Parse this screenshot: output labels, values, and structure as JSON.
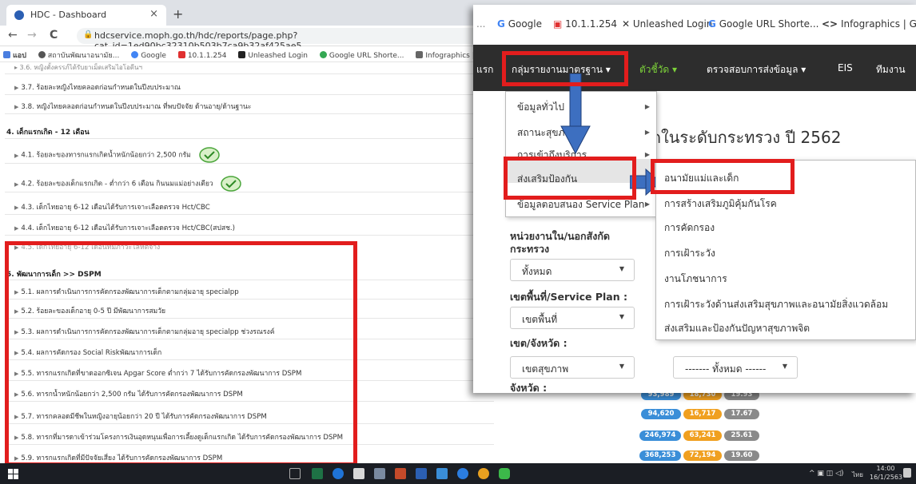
{
  "browser": {
    "tab_title": "HDC - Dashboard",
    "tab_close": "×",
    "new_tab": "+",
    "back": "←",
    "forward": "→",
    "reload": "C",
    "url": "hdcservice.moph.go.th/hdc/reports/page.php?cat_id=1ed90bc32310b503b7ca9b32af425ae5",
    "bookmarks": [
      "แอป",
      "สถาบันพัฒนาอนามัย...",
      "Google",
      "10.1.1.254",
      "Unleashed Login",
      "Google URL Shorte...",
      "Infographics | Goo...",
      "Ne"
    ]
  },
  "report": {
    "cutoff_row": "▸ 3.6. หญิงตั้งครรภ์ได้รับยาเม็ดเสริมไอโอดีนฯ",
    "rows_section3": [
      "3.7. ร้อยละหญิงไทยคลอดก่อนกำหนดในปีงบประมาณ",
      "3.8. หญิงไทยคลอดก่อนกำหนดในปีงบประมาณ ที่พบปัจจัย ด้านอายุ/ด้านฐานะ"
    ],
    "section4_title": "4. เด็กแรกเกิด - 12 เดือน",
    "rows_section4": [
      "4.1. ร้อยละของทารกแรกเกิดน้ำหนักน้อยกว่า 2,500 กรัม",
      "4.2. ร้อยละของเด็กแรกเกิด - ต่ำกว่า 6 เดือน กินนมแม่อย่างเดียว",
      "4.3. เด็กไทยอายุ 6-12 เดือนได้รับการเจาะเลือดตรวจ Hct/CBC",
      "4.4. เด็กไทยอายุ 6-12 เดือนได้รับการเจาะเลือดตรวจ Hct/CBC(สปสช.)",
      "4.5. เด็กไทยอายุ 6-12 เดือนที่มีภาวะโลหิตจาง"
    ],
    "section5_title": "5. พัฒนาการเด็ก >> DSPM",
    "rows_section5": [
      "5.1. ผลการดำเนินการการคัดกรองพัฒนาการเด็กตามกลุ่มอายุ specialpp",
      "5.2. ร้อยละของเด็กอายุ 0-5 ปี มีพัฒนาการสมวัย",
      "5.3. ผลการดำเนินการการคัดกรองพัฒนาการเด็กตามกลุ่มอายุ specialpp ช่วงรณรงค์",
      "5.4. ผลการคัดกรอง Social Riskพัฒนาการเด็ก",
      "5.5. ทารกแรกเกิดที่ขาดออกซิเจน Apgar Score ต่ำกว่า 7 ได้รับการคัดกรองพัฒนาการ DSPM",
      "5.6. ทารกน้ำหนักน้อยกว่า 2,500 กรัม ได้รับการคัดกรองพัฒนาการ DSPM",
      "5.7. ทารกคลอดมีชีพในหญิงอายุน้อยกว่า 20 ปี ได้รับการคัดกรองพัฒนาการ DSPM",
      "5.8. ทารกที่มารดาเข้าร่วมโครงการเงินอุดหนุนเพื่อการเลี้ยงดูเด็กแรกเกิด ได้รับการคัดกรองพัฒนาการ DSPM",
      "5.9. ทารกแรกเกิดที่มีปัจจัยเสี่ยง ได้รับการคัดกรองพัฒนาการ DSPM"
    ],
    "badges": [
      {
        "a": "93,989",
        "b": "18,730",
        "c": "19.93"
      },
      {
        "a": "94,620",
        "b": "16,717",
        "c": "17.67"
      },
      {
        "a": "246,974",
        "b": "63,241",
        "c": "25.61"
      },
      {
        "a": "368,253",
        "b": "72,194",
        "c": "19.60"
      }
    ],
    "badge_colors": {
      "blue": "#3a8ed8",
      "orange": "#f0a020",
      "gray": "#8a8a8a"
    }
  },
  "overlay": {
    "bookmarks": [
      "Google",
      "10.1.1.254",
      "Unleashed Login",
      "Google URL Shorte...",
      "Infographics | Go"
    ],
    "nav": {
      "first": "แรก",
      "standard_reports": "กลุ่มรายงานมาตรฐาน ▾",
      "indicators": "ตัวชี้วัด ▾",
      "data_check": "ตรวจสอบการส่งข้อมูล ▾",
      "eis": "EIS",
      "team": "ทีมงาน"
    },
    "heading": "ดในระดับกระทรวง ปี 2562",
    "menu": [
      "ข้อมูลทั่วไป",
      "สถานะสุขภาพ",
      "การเข้าถึงบริการ",
      "ส่งเสริมป้องกัน",
      "ข้อมูลตอบสนอง Service Plan"
    ],
    "submenu": [
      "อนามัยแม่และเด็ก",
      "การสร้างเสริมภูมิคุ้มกันโรค",
      "การคัดกรอง",
      "การเฝ้าระวัง",
      "งานโภชนาการ",
      "การเฝ้าระวังด้านส่งเสริมสุขภาพและอนามัยสิ่งแวดล้อม",
      "ส่งเสริมและป้องกันปัญหาสุขภาพจิต"
    ],
    "form": {
      "unit_label": "หน่วยงานใน/นอกสังกัด",
      "unit_label2": "กระทรวง",
      "unit_value": "ทั้งหมด",
      "zone_label": "เขตพื้นที่/Service Plan :",
      "zone_value": "เขตพื้นที่",
      "province_label": "เขต/จังหวัด :",
      "province_value": "เขตสุขภาพ",
      "all_value": "------- ทั้งหมด ------",
      "changwat_label": "จังหวัด :"
    }
  },
  "taskbar": {
    "time": "14:00",
    "date": "16/1/2563",
    "lang": "ไทย"
  }
}
